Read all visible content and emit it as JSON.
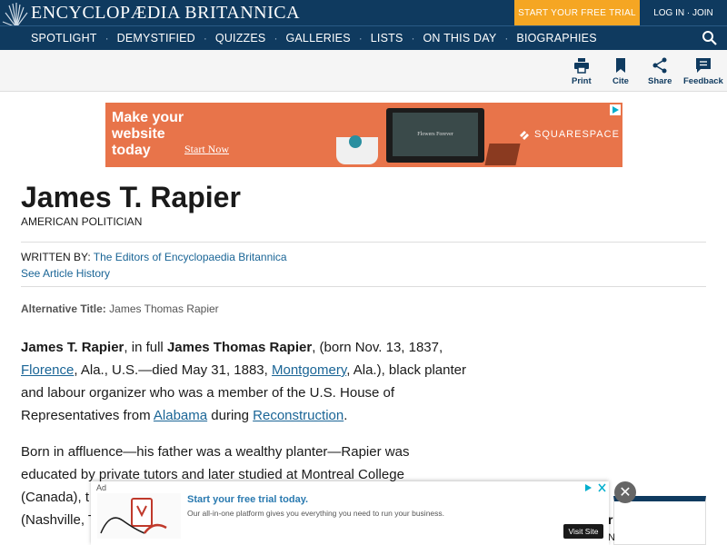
{
  "header": {
    "brand": "ENCYCLOPÆDIA BRITANNICA",
    "trial_label": "START YOUR FREE TRIAL",
    "login_label": "LOG IN · JOIN",
    "nav": [
      "SPOTLIGHT",
      "DEMYSTIFIED",
      "QUIZZES",
      "GALLERIES",
      "LISTS",
      "ON THIS DAY",
      "BIOGRAPHIES"
    ],
    "nav_separator": "·"
  },
  "toolbar": {
    "print": "Print",
    "cite": "Cite",
    "share": "Share",
    "feedback": "Feedback"
  },
  "ad_banner": {
    "headline": "Make your website today",
    "cta": "Start Now",
    "screen_text": "Flowers Forever",
    "brand": "SQUARESPACE"
  },
  "article": {
    "title": "James T. Rapier",
    "subtitle": "AMERICAN POLITICIAN",
    "written_by_label": "WRITTEN BY:",
    "written_by": "The Editors of Encyclopaedia Britannica",
    "history_link": "See Article History",
    "alt_label": "Alternative Title:",
    "alt_value": "James Thomas Rapier",
    "p1": {
      "name": "James T. Rapier",
      "t1": ", in full ",
      "fullname": "James Thomas Rapier",
      "t2": ", (born Nov. 13, 1837, ",
      "link1": "Florence",
      "t3": ", Ala., U.S.—died May 31, 1883, ",
      "link2": "Montgomery",
      "t4": ", Ala.), black planter and labour organizer who was a member of the U.S. House of Representatives from ",
      "link3": "Alabama",
      "t5": " during ",
      "link4": "Reconstruction",
      "t6": "."
    },
    "p2": {
      "l1": "Born in affluence—his father was a wealthy planter—Rapier was",
      "l2": "educated by private tutors and later studied at Montreal College",
      "l3": "(Canada), t",
      "l4": "(Nashville, T"
    }
  },
  "side": {
    "letter1": "r",
    "letter2": "N"
  },
  "bottom_ad": {
    "tag": "Ad",
    "title": "Start your free trial today.",
    "text": "Our all-in-one platform gives you everything you need to run your business.",
    "visit": "Visit Site",
    "close": "✕"
  },
  "colors": {
    "brand_navy": "#0f3a5f",
    "trial_orange": "#f5a623",
    "ad_orange": "#e8744a",
    "link_blue": "#1a6596"
  }
}
